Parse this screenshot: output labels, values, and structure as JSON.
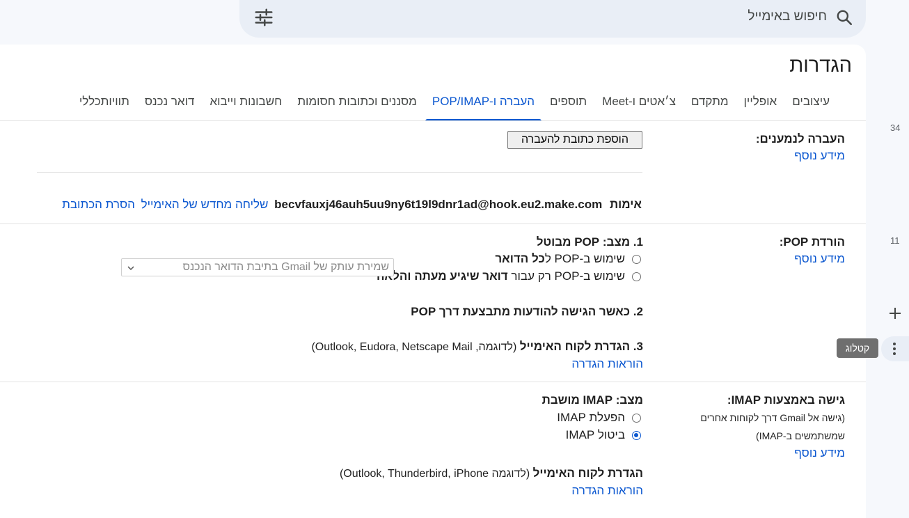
{
  "search": {
    "placeholder": "חיפוש באימייל",
    "icon": "search-icon",
    "options_icon": "tune-icon"
  },
  "settings": {
    "title": "הגדרות",
    "tabs": [
      {
        "label": "כללי",
        "active": false
      },
      {
        "label": "תוויות",
        "active": false
      },
      {
        "label": "דואר נכנס",
        "active": false
      },
      {
        "label": "חשבונות וייבוא",
        "active": false
      },
      {
        "label": "מסננים וכתובות חסומות",
        "active": false
      },
      {
        "label": "העברה ו-POP/IMAP",
        "active": true
      },
      {
        "label": "תוספים",
        "active": false
      },
      {
        "label": "צ׳אטים ו-Meet",
        "active": false
      },
      {
        "label": "מתקדם",
        "active": false
      },
      {
        "label": "אופליין",
        "active": false
      },
      {
        "label": "עיצובים",
        "active": false
      }
    ]
  },
  "forwarding": {
    "label": "העברה לנמענים:",
    "learn_more": "מידע נוסף",
    "add_button": "הוספת כתובת להעברה",
    "verify_label": "אימות",
    "address": "becvfauxj46auh5uu9ny6t19l9dnr1ad@hook.eu2.make.com",
    "resend_link": "שליחה מחדש של האימייל",
    "remove_link": "הסרת הכתובת"
  },
  "pop": {
    "label": "הורדת POP:",
    "learn_more": "מידע נוסף",
    "status": "1. מצב: POP מבוטל",
    "option_all_prefix": "שימוש ב-POP ל",
    "option_all_bold": "כל הדואר",
    "option_new_prefix": "שימוש ב-POP רק עבור ",
    "option_new_bold": "דואר שיגיע מעתה והלאה",
    "when_access": "2. כאשר הגישה להודעות מתבצעת דרך POP",
    "select_value": "שמירת עותק של Gmail בתיבת הדואר הנכנס",
    "client_title": "3. הגדרת לקוח האימייל",
    "client_examples": " (לדוגמה, Outlook, Eudora, Netscape Mail)",
    "instructions": "הוראות הגדרה"
  },
  "imap": {
    "label": "גישה באמצעות IMAP:",
    "sub1": "(גישה אל Gmail דרך לקוחות אחרים",
    "sub2": "שמשתמשים ב-IMAP)",
    "learn_more": "מידע נוסף",
    "status": "מצב: IMAP מושבת",
    "enable": "הפעלת IMAP",
    "disable": "ביטול IMAP",
    "selected": "disable",
    "client_title": "הגדרת לקוח האימייל",
    "client_examples": " (לדוגמה Outlook, Thunderbird, iPhone)",
    "instructions": "הוראות הגדרה"
  },
  "rail": {
    "badge_top": "34",
    "badge_bottom": "11",
    "tooltip": "קטלוג"
  }
}
